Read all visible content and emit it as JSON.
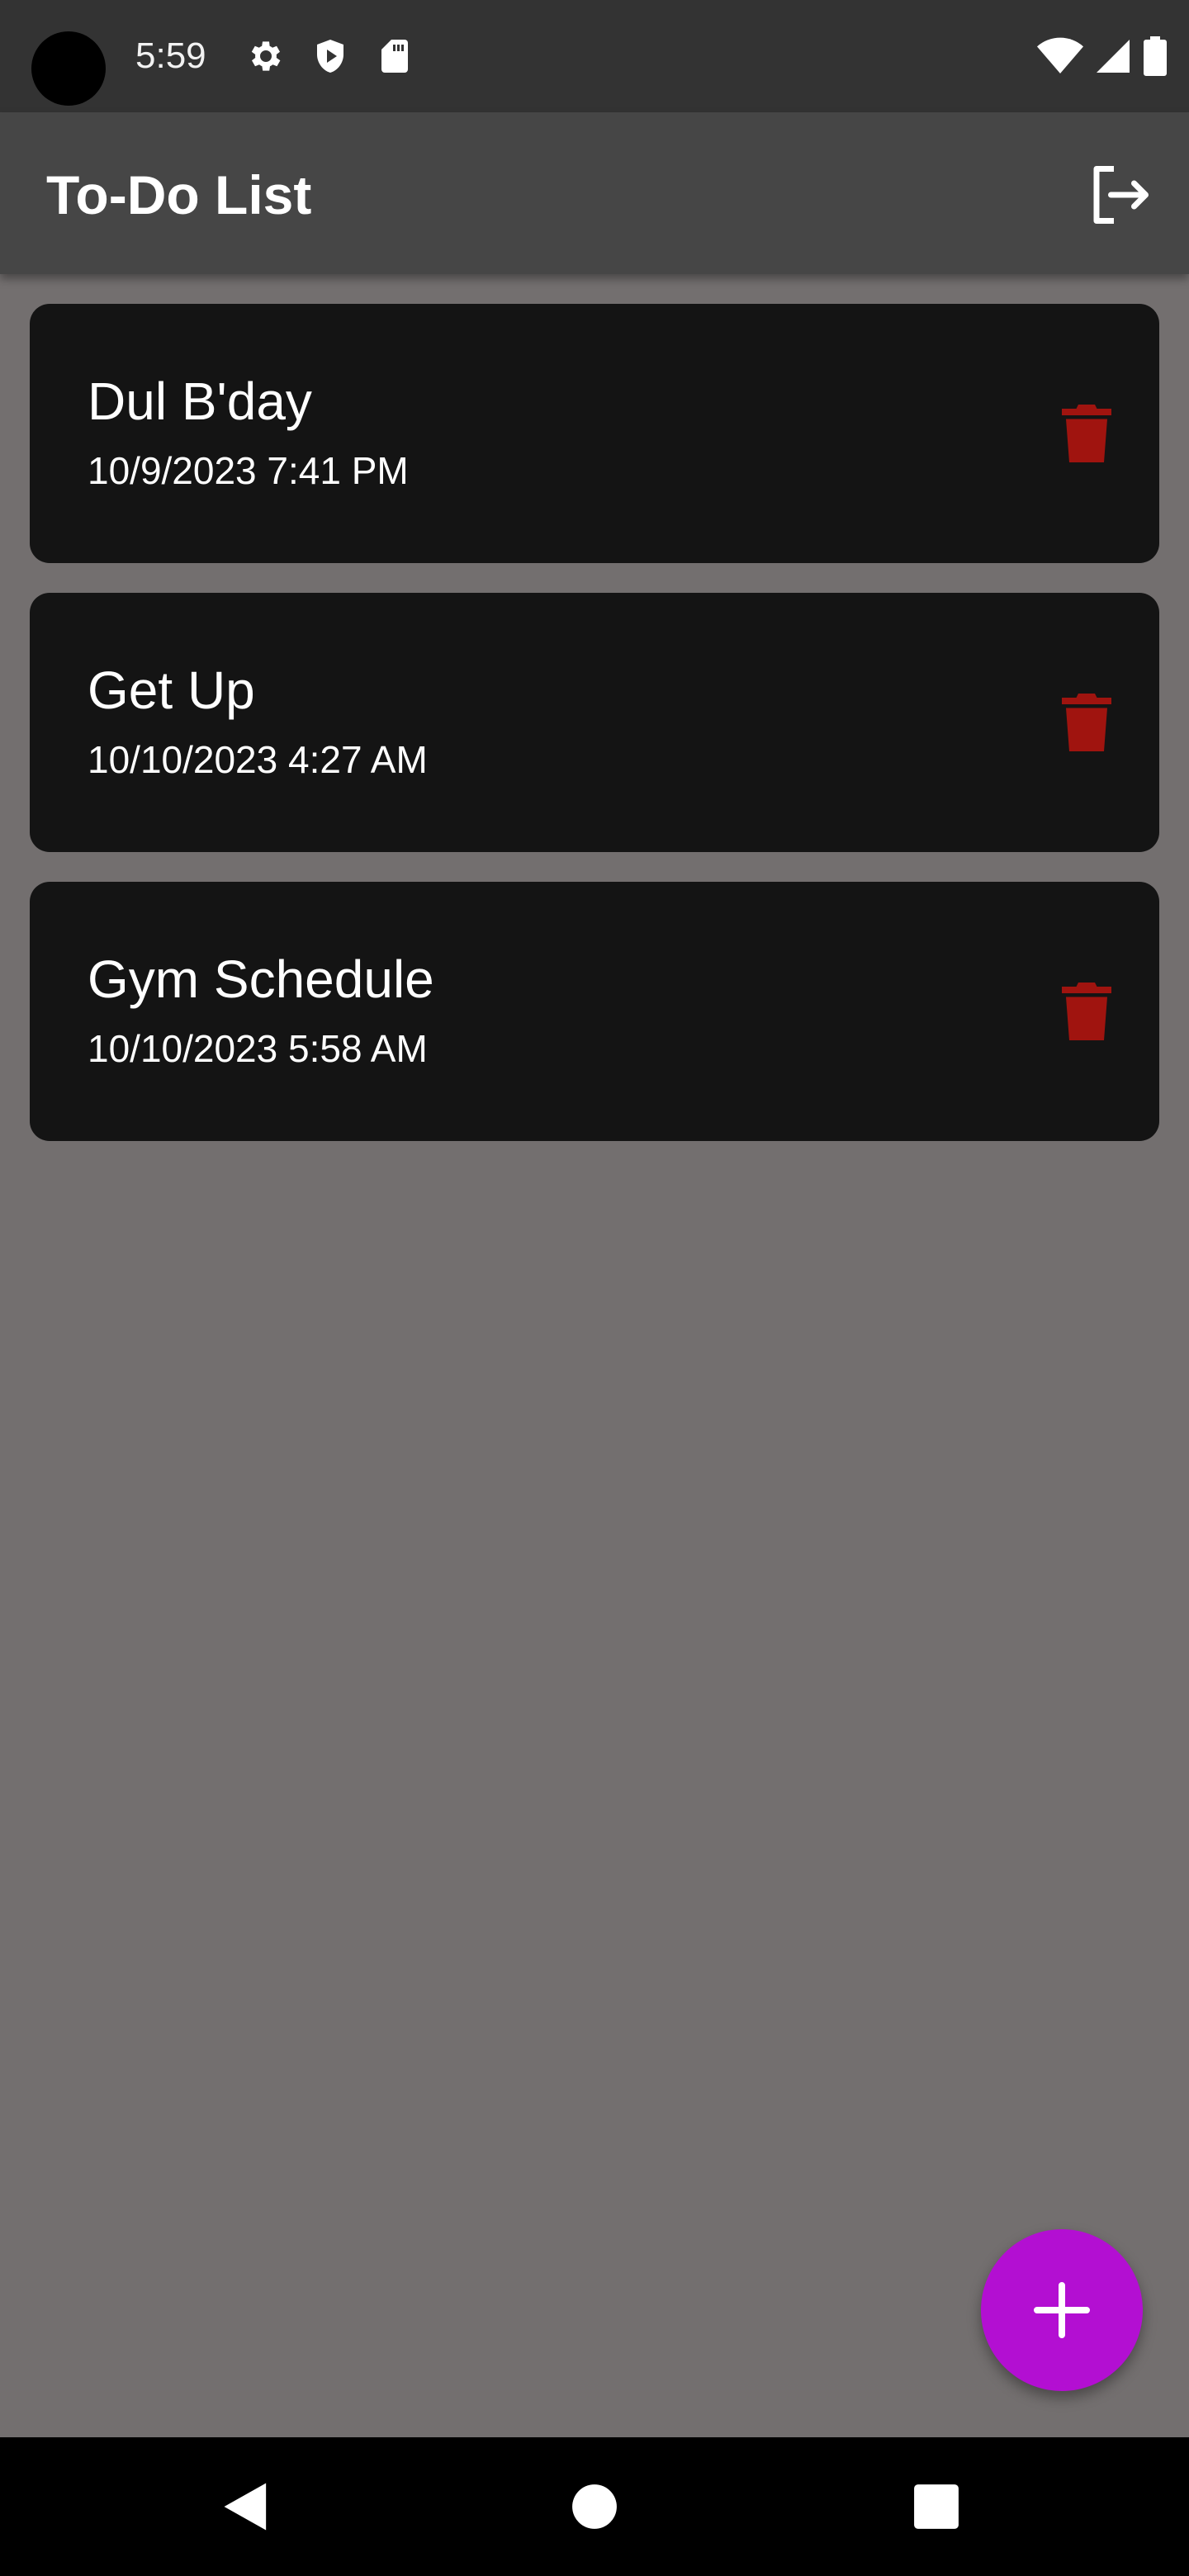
{
  "status_bar": {
    "time": "5:59",
    "icons": [
      "gear-icon",
      "shield-play-icon",
      "sd-card-icon",
      "wifi-icon",
      "cell-signal-icon",
      "battery-icon"
    ]
  },
  "app_bar": {
    "title": "To-Do List",
    "action_icon": "logout-icon"
  },
  "tasks": [
    {
      "title": "Dul B'day",
      "datetime": "10/9/2023 7:41 PM",
      "action_icon": "trash-icon"
    },
    {
      "title": "Get Up",
      "datetime": "10/10/2023 4:27 AM",
      "action_icon": "trash-icon"
    },
    {
      "title": "Gym Schedule",
      "datetime": "10/10/2023 5:58 AM",
      "action_icon": "trash-icon"
    }
  ],
  "fab": {
    "icon": "plus-icon"
  },
  "nav_bar": {
    "icons": [
      "back-icon",
      "home-icon",
      "recents-icon"
    ]
  },
  "colors": {
    "background": "#736f6f",
    "app_bar": "#464646",
    "status_bar": "#333333",
    "card": "#141414",
    "delete": "#a0140f",
    "fab": "#b30fd2"
  }
}
